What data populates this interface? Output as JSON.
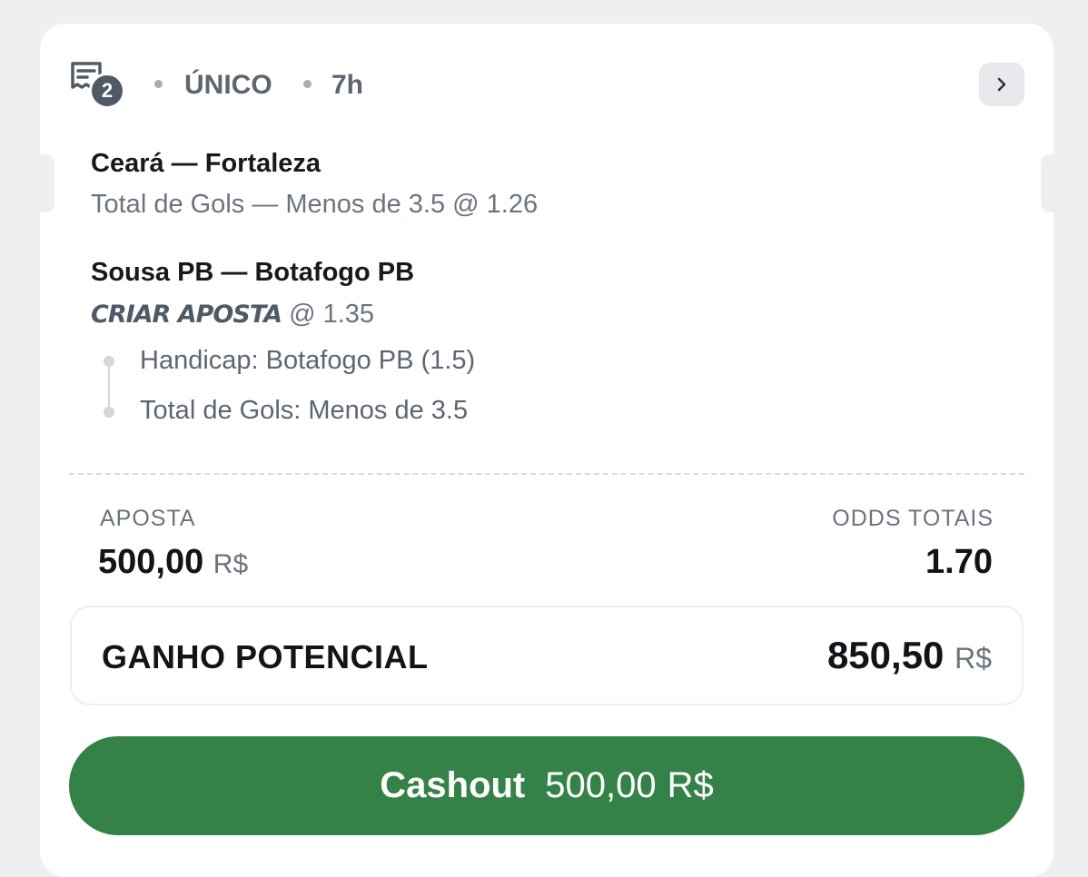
{
  "header": {
    "selections_count": "2",
    "bet_type": "ÚNICO",
    "time_ago": "7h"
  },
  "selections": [
    {
      "match": "Ceará — Fortaleza",
      "market": "Total de Gols — Menos de 3.5",
      "odd": "@ 1.26"
    },
    {
      "match": "Sousa PB — Botafogo PB",
      "market_tag": "CRIAR APOSTA",
      "odd": "@ 1.35",
      "legs": [
        "Handicap: Botafogo PB (1.5)",
        "Total de Gols: Menos de 3.5"
      ]
    }
  ],
  "summary": {
    "stake_label": "APOSTA",
    "stake_value": "500,00",
    "stake_currency": "R$",
    "odds_label": "ODDS TOTAIS",
    "odds_value": "1.70"
  },
  "potential": {
    "label": "GANHO POTENCIAL",
    "value": "850,50",
    "currency": "R$"
  },
  "cashout": {
    "label": "Cashout",
    "amount": "500,00",
    "currency": "R$"
  },
  "colors": {
    "accent_green": "#358248",
    "badge_gray": "#505a66"
  }
}
